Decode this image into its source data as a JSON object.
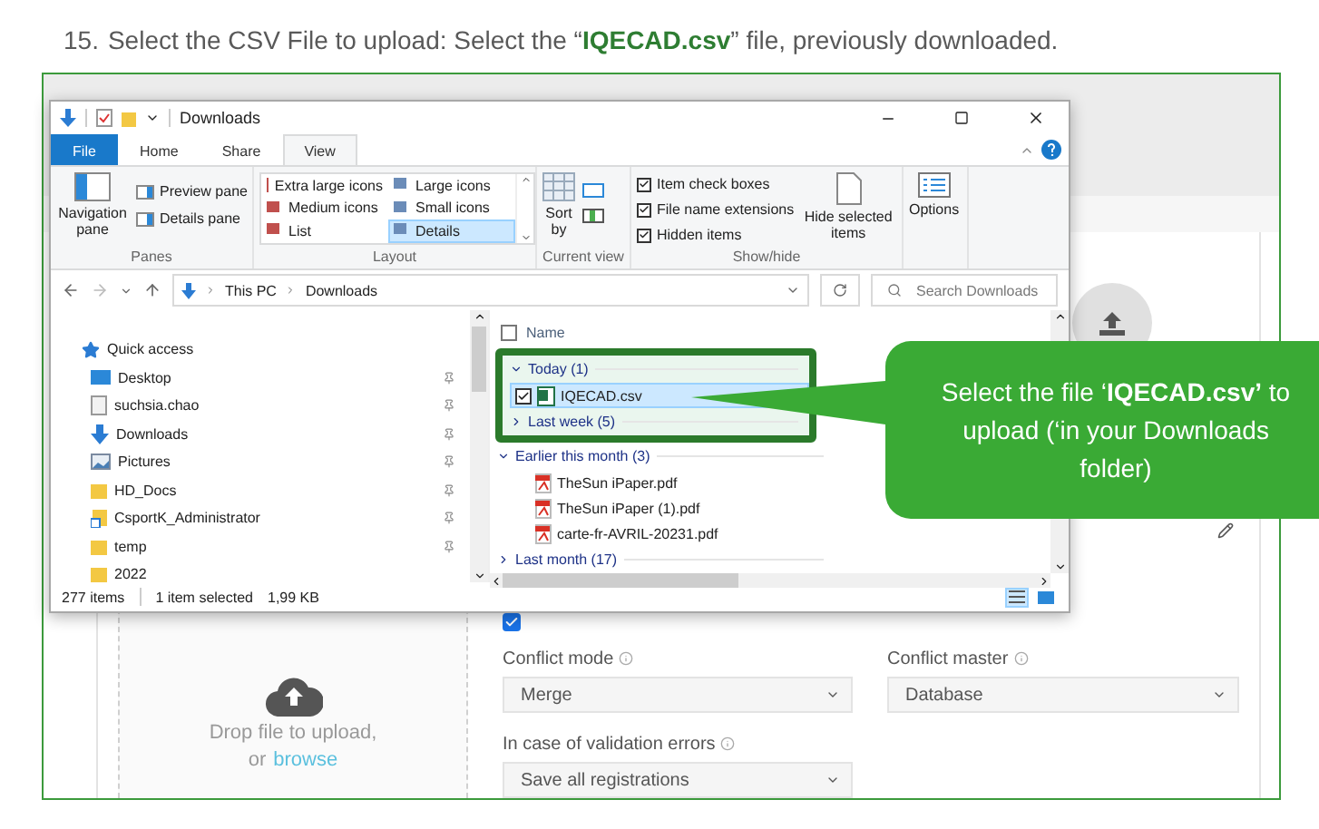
{
  "instruction": {
    "number": "15.",
    "text": "Select the CSV File to upload: Select the “**IQECAD.csv**” file, previously downloaded."
  },
  "explorer": {
    "title": "Downloads",
    "tabs": [
      {
        "label": "File",
        "kind": "file",
        "selected": false
      },
      {
        "label": "Home",
        "kind": "tab",
        "selected": false
      },
      {
        "label": "Share",
        "kind": "tab",
        "selected": false
      },
      {
        "label": "View",
        "kind": "tab",
        "selected": true
      }
    ],
    "panes": {
      "label": "Panes",
      "navigation_pane": "Navigation pane",
      "items": [
        "Preview pane",
        "Details pane"
      ]
    },
    "layout": {
      "label": "Layout",
      "items": [
        {
          "label": "Extra large icons",
          "selected": false
        },
        {
          "label": "Large icons",
          "selected": false
        },
        {
          "label": "Medium icons",
          "selected": false
        },
        {
          "label": "Small icons",
          "selected": false
        },
        {
          "label": "List",
          "selected": false
        },
        {
          "label": "Details",
          "selected": true
        }
      ]
    },
    "current_view": {
      "label": "Current view",
      "sort": "Sort by"
    },
    "show_hide": {
      "label": "Show/hide",
      "checkboxes": [
        {
          "label": "Item check boxes",
          "checked": true
        },
        {
          "label": "File name extensions",
          "checked": true
        },
        {
          "label": "Hidden items",
          "checked": true
        }
      ],
      "hide_selected": "Hide selected items"
    },
    "options": "Options",
    "path": [
      "This PC",
      "Downloads"
    ],
    "search": {
      "placeholder": "Search Downloads"
    },
    "navigation": [
      {
        "label": "Quick access",
        "kind": "star",
        "pinned": false
      },
      {
        "label": "Desktop",
        "kind": "desktop",
        "pinned": true
      },
      {
        "label": "suchsia.chao",
        "kind": "user",
        "pinned": true
      },
      {
        "label": "Downloads",
        "kind": "download",
        "pinned": true
      },
      {
        "label": "Pictures",
        "kind": "pictures",
        "pinned": true
      },
      {
        "label": "HD_Docs",
        "kind": "folder",
        "pinned": true
      },
      {
        "label": "CsportK_Administrator",
        "kind": "shortcut",
        "pinned": true
      },
      {
        "label": "temp",
        "kind": "folder",
        "pinned": true
      },
      {
        "label": "2022",
        "kind": "folder",
        "pinned": false
      }
    ],
    "column": {
      "label": "Name",
      "checked": false
    },
    "groups": [
      {
        "label": "Today (1)",
        "expanded": true,
        "annotated": true,
        "files": [
          {
            "name": "IQECAD.csv",
            "kind": "csv",
            "selected": true,
            "checked": true
          }
        ]
      },
      {
        "label": "Last week (5)",
        "expanded": false,
        "annotated": true
      },
      {
        "label": "Earlier this month (3)",
        "expanded": true,
        "annotated": false,
        "files": [
          {
            "name": "TheSun iPaper.pdf",
            "kind": "pdf",
            "selected": false,
            "checked": false
          },
          {
            "name": "TheSun iPaper (1).pdf",
            "kind": "pdf",
            "selected": false,
            "checked": false
          },
          {
            "name": "carte-fr-AVRIL-20231.pdf",
            "kind": "pdf",
            "selected": false,
            "checked": false
          }
        ]
      },
      {
        "label": "Last month (17)",
        "expanded": false,
        "annotated": false
      }
    ],
    "status": {
      "count": "277 items",
      "selection": "1 item selected",
      "size": "1,99 KB"
    }
  },
  "app": {
    "use_default": {
      "checked": true
    },
    "upload": {
      "text": "Drop file to upload,",
      "or": "or",
      "link": "browse"
    },
    "fields": [
      {
        "label": "Conflict mode",
        "value": "Merge"
      },
      {
        "label": "Conflict master",
        "value": "Database"
      },
      {
        "label": "In case of validation errors",
        "value": "Save all registrations"
      }
    ]
  },
  "callout": {
    "text": "Select the file ‘**IQECAD.csv’** to upload (‘in your Downloads folder)"
  }
}
